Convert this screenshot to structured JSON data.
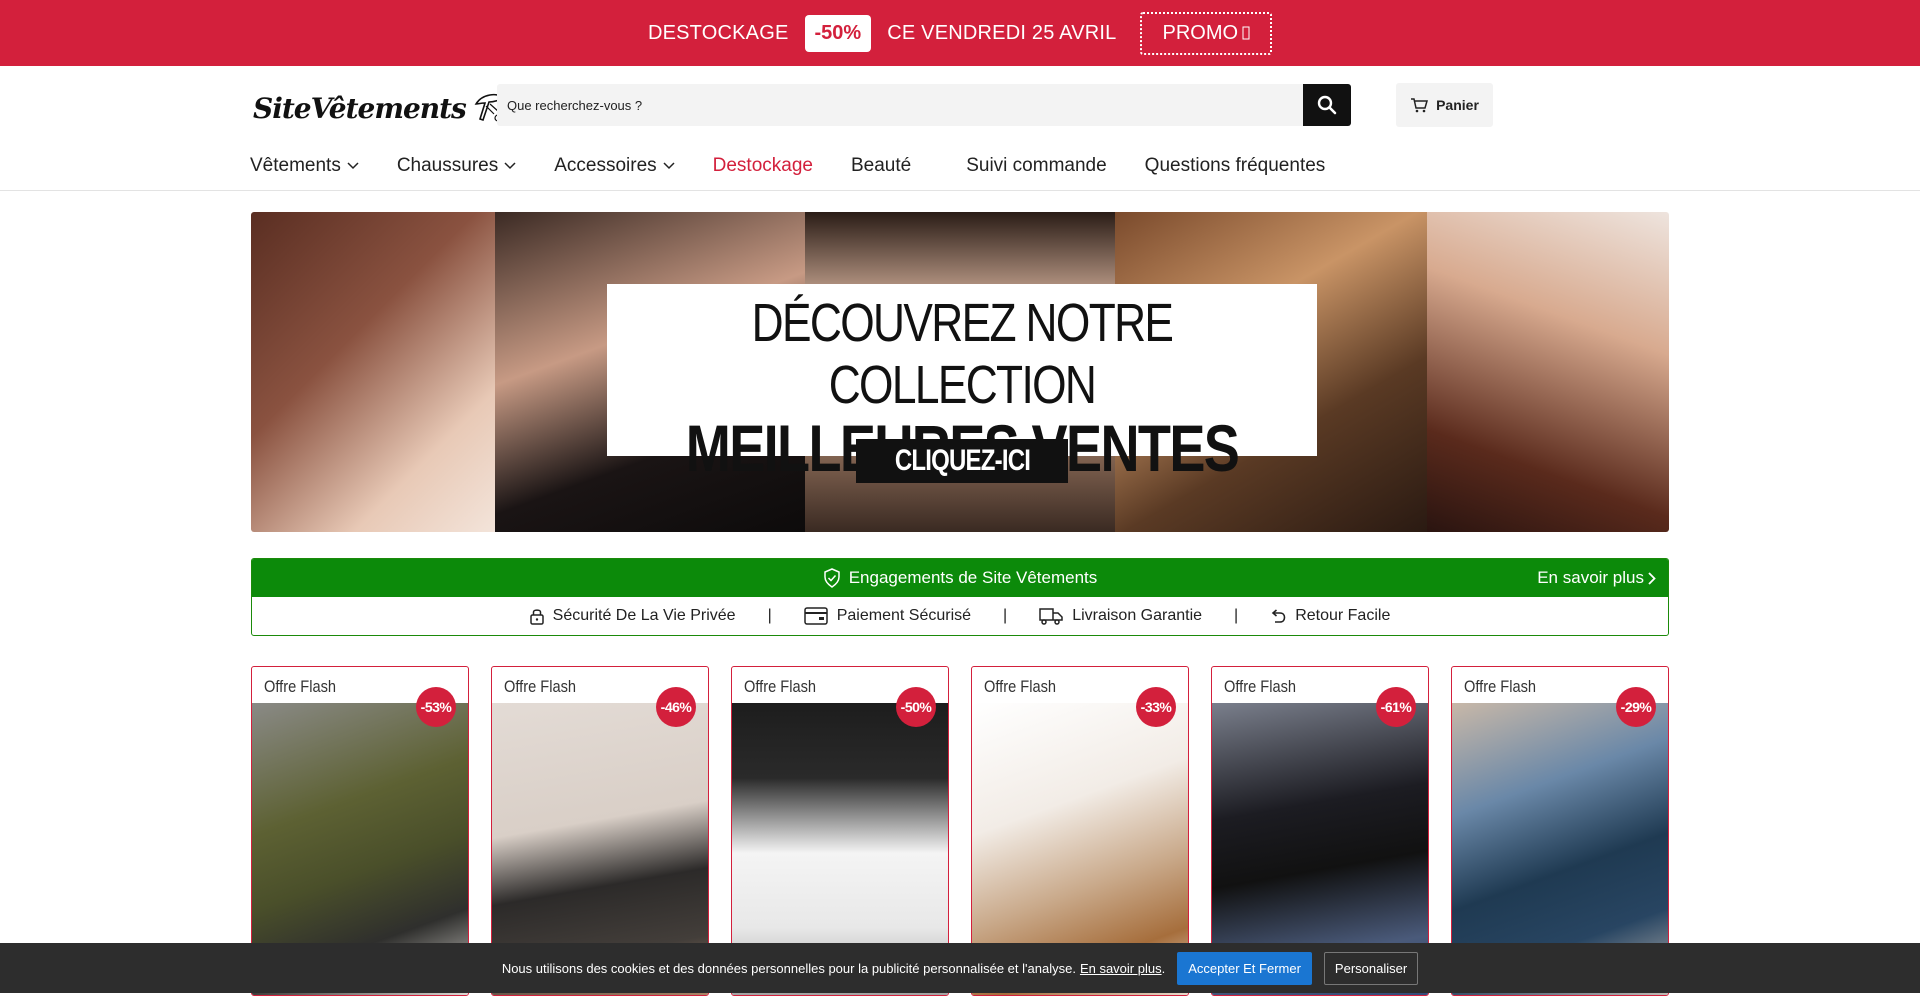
{
  "promo": {
    "text_before": "DESTOCKAGE",
    "badge": "-50%",
    "text_after": "CE VENDREDI 25 AVRIL",
    "button_label": "PROMO"
  },
  "header": {
    "logo_text": "SiteVêtements",
    "search_placeholder": "Que recherchez-vous ?",
    "cart_label": "Panier"
  },
  "nav": {
    "items": [
      {
        "label": "Vêtements"
      },
      {
        "label": "Chaussures"
      },
      {
        "label": "Accessoires"
      },
      {
        "label": "Destockage"
      },
      {
        "label": "Beauté"
      },
      {
        "label": "Suivi commande"
      },
      {
        "label": "Questions fréquentes"
      }
    ]
  },
  "hero": {
    "line1": "DÉCOUVREZ NOTRE COLLECTION",
    "line2": "MEILLEURES VENTES",
    "cta": "CLIQUEZ-ICI"
  },
  "engagements": {
    "title": "Engagements de Site Vêtements",
    "more": "En savoir plus",
    "items": [
      {
        "label": "Sécurité De La Vie Privée",
        "icon": "lock-icon"
      },
      {
        "label": "Paiement Sécurisé",
        "icon": "card-icon"
      },
      {
        "label": "Livraison Garantie",
        "icon": "truck-icon"
      },
      {
        "label": "Retour Facile",
        "icon": "return-icon"
      }
    ],
    "separator": "|"
  },
  "products": [
    {
      "label": "Offre Flash",
      "discount": "-53%"
    },
    {
      "label": "Offre Flash",
      "discount": "-46%"
    },
    {
      "label": "Offre Flash",
      "discount": "-50%"
    },
    {
      "label": "Offre Flash",
      "discount": "-33%"
    },
    {
      "label": "Offre Flash",
      "discount": "-61%"
    },
    {
      "label": "Offre Flash",
      "discount": "-29%"
    }
  ],
  "cookie": {
    "text": "Nous utilisons des cookies et des données personnelles pour la publicité personnalisée et l'analyse.",
    "link": "En savoir plus",
    "period": ".",
    "accept": "Accepter Et Fermer",
    "customize": "Personaliser"
  },
  "colors": {
    "brand_red": "#d3203c",
    "engage_green": "#0c8a0a",
    "cookie_bg": "#2d2d2d",
    "accept_blue": "#1a76d2"
  }
}
